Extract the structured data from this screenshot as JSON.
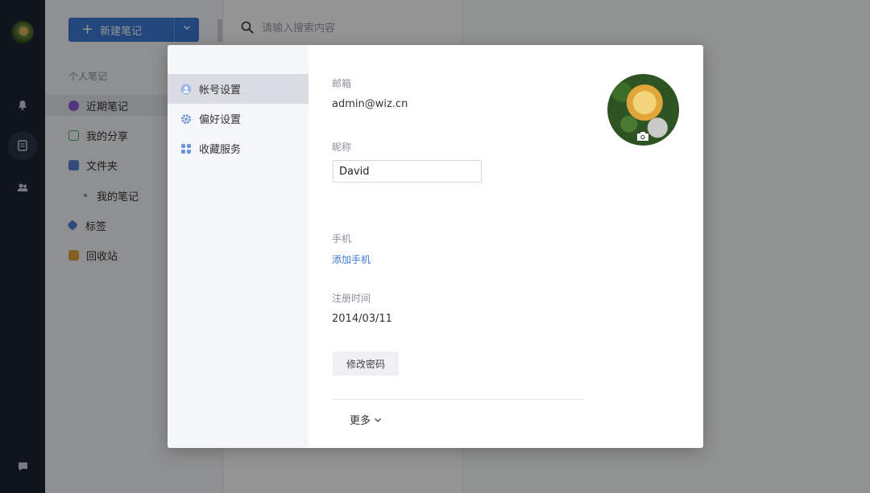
{
  "app": {
    "new_note_label": "新建笔记",
    "search_placeholder": "请输入搜索内容",
    "nav": {
      "section_label": "个人笔记",
      "items": [
        {
          "label": "近期笔记",
          "color": "#8e5bd6"
        },
        {
          "label": "我的分享",
          "color": "#4caf72"
        },
        {
          "label": "文件夹",
          "color": "#5b7fd6"
        },
        {
          "label": "我的笔记",
          "color": "#8a9099"
        },
        {
          "label": "标签",
          "color": "#5b7fd6"
        },
        {
          "label": "回收站",
          "color": "#e0a63a"
        }
      ]
    }
  },
  "modal": {
    "tabs": [
      {
        "label": "帐号设置",
        "icon": "user-icon",
        "active": true
      },
      {
        "label": "偏好设置",
        "icon": "gear-icon",
        "active": false
      },
      {
        "label": "收藏服务",
        "icon": "grid-icon",
        "active": false
      }
    ],
    "email_label": "邮箱",
    "email_value": "admin@wiz.cn",
    "nickname_label": "昵称",
    "nickname_value": "David",
    "phone_label": "手机",
    "add_phone_link": "添加手机",
    "register_label": "注册时间",
    "register_value": "2014/03/11",
    "change_password_label": "修改密码",
    "more_label": "更多"
  },
  "colors": {
    "accent": "#3c7bd6",
    "rail": "#1d2533"
  }
}
